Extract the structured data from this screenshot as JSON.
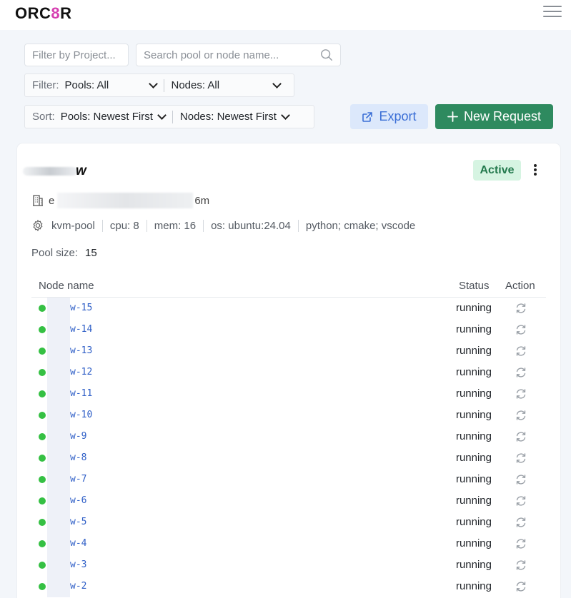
{
  "header": {
    "logo_prefix": "ORC",
    "logo_eight": "8",
    "logo_suffix": "R",
    "menu_icon": "hamburger-icon"
  },
  "filters": {
    "project_placeholder": "Filter by Project...",
    "search_placeholder": "Search pool or node name...",
    "filter_label": "Filter:",
    "pools_filter": "Pools: All",
    "nodes_filter": "Nodes: All",
    "sort_label": "Sort:",
    "pools_sort": "Pools: Newest First",
    "nodes_sort": "Nodes: Newest First"
  },
  "actions": {
    "export_label": "Export",
    "new_request_label": "New Request"
  },
  "pool": {
    "name_suffix": "w",
    "status": "Active",
    "project_prefix": "e",
    "project_suffix": "6m",
    "specs": [
      "kvm-pool",
      "cpu: 8",
      "mem: 16",
      "os: ubuntu:24.04",
      "python; cmake; vscode"
    ],
    "size_label": "Pool size:",
    "size_value": "15"
  },
  "table": {
    "headers": {
      "name": "Node name",
      "status": "Status",
      "action": "Action"
    },
    "rows": [
      {
        "name": "w-15",
        "status": "running"
      },
      {
        "name": "w-14",
        "status": "running"
      },
      {
        "name": "w-13",
        "status": "running"
      },
      {
        "name": "w-12",
        "status": "running"
      },
      {
        "name": "w-11",
        "status": "running"
      },
      {
        "name": "w-10",
        "status": "running"
      },
      {
        "name": "w-9",
        "status": "running"
      },
      {
        "name": "w-8",
        "status": "running"
      },
      {
        "name": "w-7",
        "status": "running"
      },
      {
        "name": "w-6",
        "status": "running"
      },
      {
        "name": "w-5",
        "status": "running"
      },
      {
        "name": "w-4",
        "status": "running"
      },
      {
        "name": "w-3",
        "status": "running"
      },
      {
        "name": "w-2",
        "status": "running"
      }
    ]
  },
  "colors": {
    "accent_green": "#2e8a5f",
    "running_dot": "#35c043",
    "active_badge_bg": "#d6f4e2",
    "export_bg": "#dce8fb"
  }
}
